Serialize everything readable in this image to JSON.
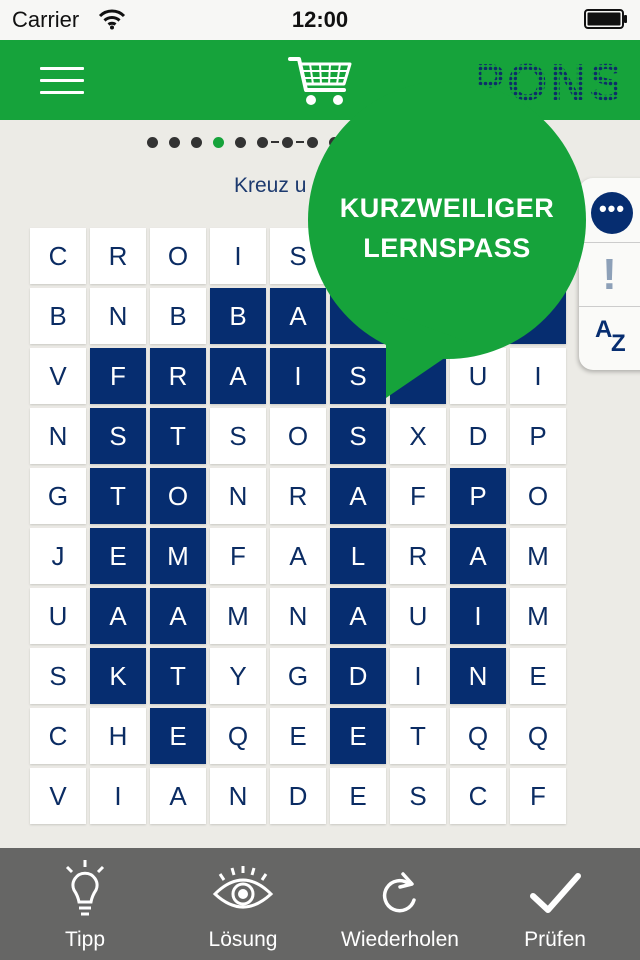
{
  "status_bar": {
    "carrier": "Carrier",
    "time": "12:00"
  },
  "header": {
    "logo": "PONS",
    "icons": [
      "hamburger-menu-icon",
      "cart-icon"
    ]
  },
  "progress": {
    "total": 9,
    "active_index": 3
  },
  "instruction": "Kreuz u",
  "grid": {
    "rows": [
      [
        "C",
        "R",
        "O",
        "I",
        "S",
        "",
        "",
        "",
        ""
      ],
      [
        "B",
        "N",
        "B",
        "B",
        "A",
        "",
        "",
        "",
        ""
      ],
      [
        "V",
        "F",
        "R",
        "A",
        "I",
        "S",
        "",
        "U",
        "I"
      ],
      [
        "N",
        "S",
        "T",
        "S",
        "O",
        "S",
        "X",
        "D",
        "P"
      ],
      [
        "G",
        "T",
        "O",
        "N",
        "R",
        "A",
        "F",
        "P",
        "O"
      ],
      [
        "J",
        "E",
        "M",
        "F",
        "A",
        "L",
        "R",
        "A",
        "M"
      ],
      [
        "U",
        "A",
        "A",
        "M",
        "N",
        "A",
        "U",
        "I",
        "M"
      ],
      [
        "S",
        "K",
        "T",
        "Y",
        "G",
        "D",
        "I",
        "N",
        "E"
      ],
      [
        "C",
        "H",
        "E",
        "Q",
        "E",
        "E",
        "T",
        "Q",
        "Q"
      ],
      [
        "V",
        "I",
        "A",
        "N",
        "D",
        "E",
        "S",
        "C",
        "F"
      ]
    ],
    "selected": [
      [
        1,
        3
      ],
      [
        1,
        4
      ],
      [
        1,
        5
      ],
      [
        1,
        8
      ],
      [
        2,
        1
      ],
      [
        2,
        2
      ],
      [
        2,
        3
      ],
      [
        2,
        4
      ],
      [
        2,
        5
      ],
      [
        2,
        6
      ],
      [
        3,
        1
      ],
      [
        3,
        2
      ],
      [
        3,
        5
      ],
      [
        4,
        1
      ],
      [
        4,
        2
      ],
      [
        4,
        5
      ],
      [
        4,
        7
      ],
      [
        5,
        1
      ],
      [
        5,
        2
      ],
      [
        5,
        5
      ],
      [
        5,
        7
      ],
      [
        6,
        1
      ],
      [
        6,
        2
      ],
      [
        6,
        5
      ],
      [
        6,
        7
      ],
      [
        7,
        1
      ],
      [
        7,
        2
      ],
      [
        7,
        5
      ],
      [
        7,
        7
      ],
      [
        8,
        2
      ],
      [
        8,
        5
      ]
    ]
  },
  "side_tabs": [
    {
      "name": "chat",
      "icon": "chat-bubble-icon"
    },
    {
      "name": "hint",
      "label": "!"
    },
    {
      "name": "dictionary",
      "label_a": "A",
      "label_z": "Z"
    }
  ],
  "promo": {
    "line1": "KURZWEILIGER",
    "line2": "LERNSPASS"
  },
  "toolbar": {
    "items": [
      {
        "label": "Tipp",
        "icon": "lightbulb-icon"
      },
      {
        "label": "Lösung",
        "icon": "eye-icon"
      },
      {
        "label": "Wiederholen",
        "icon": "refresh-icon"
      },
      {
        "label": "Prüfen",
        "icon": "checkmark-icon"
      }
    ]
  },
  "colors": {
    "brand_green": "#16a33b",
    "navy": "#062d70",
    "toolbar": "#666665",
    "background": "#ecebe6"
  }
}
